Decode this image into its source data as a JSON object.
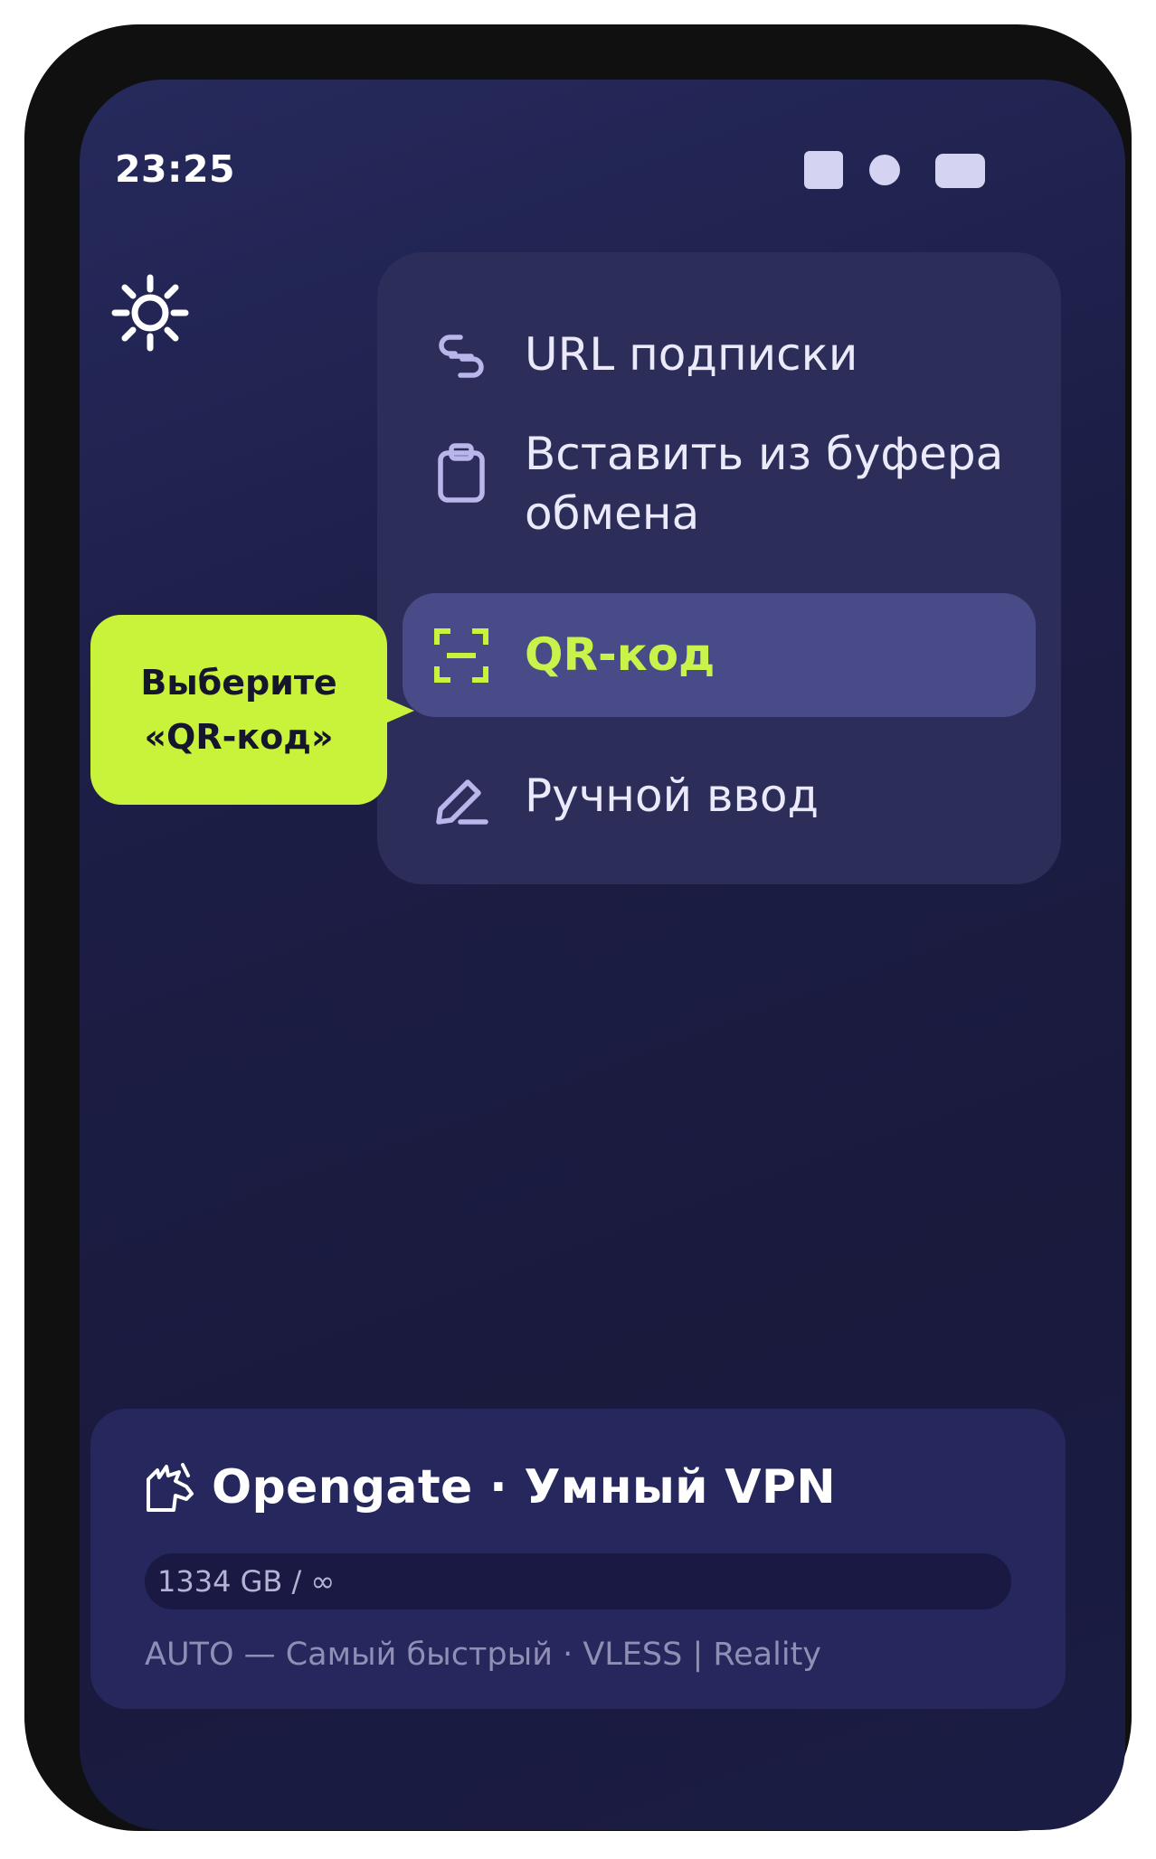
{
  "status_bar": {
    "time": "23:25",
    "icons": [
      "signal-square-icon",
      "dot-icon",
      "battery-icon"
    ]
  },
  "header": {
    "settings_icon": "gear-icon"
  },
  "menu": {
    "items": [
      {
        "label": "URL подписки",
        "icon": "link-icon",
        "selected": false
      },
      {
        "label": "Вставить из буфера обмена",
        "icon": "clipboard-icon",
        "selected": false
      },
      {
        "label": "QR-код",
        "icon": "qr-scan-icon",
        "selected": true
      },
      {
        "label": "Ручной ввод",
        "icon": "pencil-icon",
        "selected": false
      }
    ]
  },
  "tooltip": {
    "line1": "Выберите",
    "line2": "«QR-код»"
  },
  "subscription_card": {
    "logo_icon": "unicorn-icon",
    "title": "Opengate · Умный VPN",
    "traffic": "1334 GB / ∞",
    "server": "AUTO — Самый быстрый · VLESS | Reality"
  },
  "colors": {
    "background": "#1c1d45",
    "menu_bg": "#2c2d59",
    "selected_bg": "#494a88",
    "accent": "#c9f23a",
    "card_bg": "#26275c",
    "phone_frame": "#101010"
  }
}
